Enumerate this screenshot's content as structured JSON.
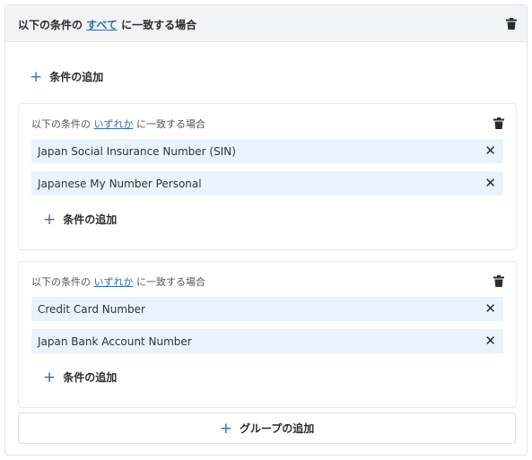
{
  "header": {
    "title_prefix": "以下の条件の",
    "match_mode": "すべて",
    "title_suffix": "に一致する場合"
  },
  "top_add_condition": "条件の追加",
  "groups": [
    {
      "title_prefix": "以下の条件の",
      "match_mode": "いずれか",
      "title_suffix": "に一致する場合",
      "conditions": [
        "Japan Social Insurance Number (SIN)",
        "Japanese My Number Personal"
      ],
      "add_condition": "条件の追加"
    },
    {
      "title_prefix": "以下の条件の",
      "match_mode": "いずれか",
      "title_suffix": "に一致する場合",
      "conditions": [
        "Credit Card Number",
        "Japan Bank Account Number"
      ],
      "add_condition": "条件の追加"
    }
  ],
  "add_group": "グループの追加",
  "icons": {
    "plus": "+",
    "close": "✕",
    "trash": "trash-icon"
  },
  "colors": {
    "accent": "#2f6fb3",
    "row_bg": "#e9f3fc",
    "header_bg": "#f2f3f5"
  }
}
